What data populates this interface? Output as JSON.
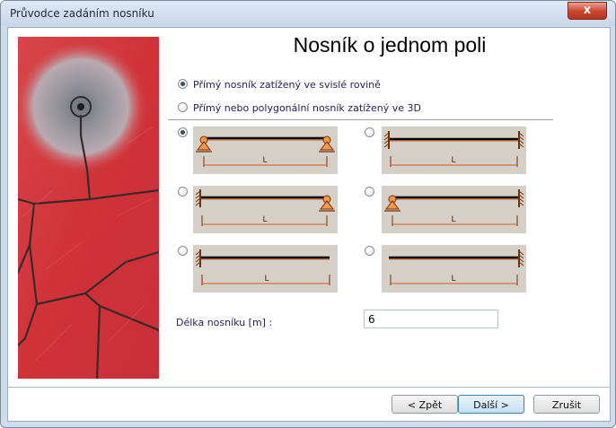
{
  "window": {
    "title": "Průvodce zadáním nosníku",
    "close_glyph": "x"
  },
  "main": {
    "heading": "Nosník o jednom poli",
    "plane_options": [
      {
        "label": "Přímý nosník zatížený ve svislé rovině",
        "checked": true
      },
      {
        "label": "Přímý nebo polygonální nosník zatížený ve 3D",
        "checked": false
      }
    ],
    "support_options": [
      {
        "id": "pinned-pinned",
        "checked": true,
        "span_label": "L"
      },
      {
        "id": "fixed-fixed",
        "checked": false,
        "span_label": "L"
      },
      {
        "id": "fixed-pinned",
        "checked": false,
        "span_label": "L"
      },
      {
        "id": "pinned-fixed",
        "checked": false,
        "span_label": "L"
      },
      {
        "id": "fixed-free",
        "checked": false,
        "span_label": "L"
      },
      {
        "id": "free-fixed",
        "checked": false,
        "span_label": "L"
      }
    ],
    "length_label": "Délka nosníku [m] :",
    "length_value": "6"
  },
  "footer": {
    "back_label": "< Zpět",
    "next_label": "Další >",
    "cancel_label": "Zrušit"
  },
  "colors": {
    "beam_line": "#000000",
    "beam_accent": "#d85a16",
    "support_fill": "#f39a4a",
    "panel_gray": "#d4d0c8",
    "photo_red": "#d43a3f"
  },
  "icons": {
    "decoration": "cracked-red-surface-image",
    "supports": [
      "pin-support-icon",
      "fixed-support-icon"
    ]
  }
}
